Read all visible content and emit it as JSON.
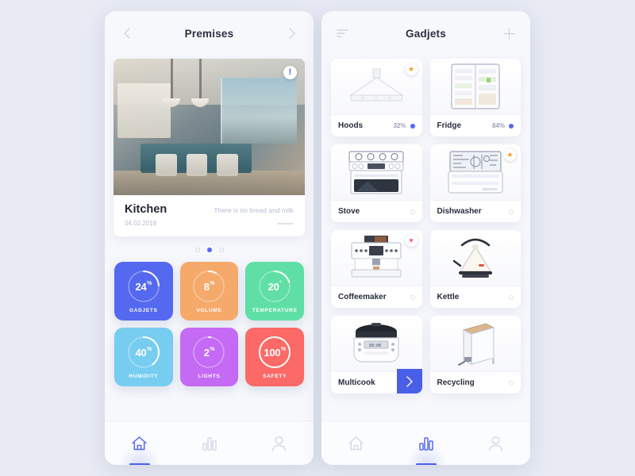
{
  "app": {
    "background_color": "#e8ebf4",
    "accent_color": "#5468f0"
  },
  "left_panel": {
    "header": {
      "title": "Premises",
      "prev_icon": "chevron-left-icon",
      "next_icon": "chevron-right-icon"
    },
    "hero": {
      "name": "Kitchen",
      "date": "04.02.2018",
      "note": "There is no bread and milk",
      "alert_badge": "!"
    },
    "pager": {
      "count": 3,
      "active_index": 1
    },
    "tiles": [
      {
        "value": "24",
        "unit": "%",
        "label": "GADJETS",
        "percent": 24,
        "color": "#5468f0"
      },
      {
        "value": "8",
        "unit": "%",
        "label": "VOLUME",
        "percent": 8,
        "color": "#f5a96b"
      },
      {
        "value": "20",
        "unit": "°",
        "label": "TEMPERATURE",
        "percent": 20,
        "color": "#5fdfa6"
      },
      {
        "value": "40",
        "unit": "%",
        "label": "HUMIDITY",
        "percent": 40,
        "color": "#76cdf0"
      },
      {
        "value": "2",
        "unit": "%",
        "label": "LIGHTS",
        "percent": 2,
        "color": "#c46af5"
      },
      {
        "value": "100",
        "unit": "%",
        "label": "SAFETY",
        "percent": 100,
        "color": "#fb6a67"
      }
    ],
    "tabs": [
      {
        "icon": "home-icon",
        "name": "tab-home",
        "active": true
      },
      {
        "icon": "chart-icon",
        "name": "tab-stats",
        "active": false
      },
      {
        "icon": "user-icon",
        "name": "tab-profile",
        "active": false
      }
    ]
  },
  "right_panel": {
    "header": {
      "title": "Gadjets",
      "filter_icon": "filter-sort-icon",
      "add_icon": "plus-icon"
    },
    "gadgets": [
      {
        "name": "Hoods",
        "percent": "32%",
        "status": "on",
        "flag": "star",
        "thumb": "range-hood-icon",
        "next": false
      },
      {
        "name": "Fridge",
        "percent": "84%",
        "status": "on",
        "flag": null,
        "thumb": "fridge-icon",
        "next": false
      },
      {
        "name": "Stove",
        "percent": "",
        "status": "off",
        "flag": null,
        "thumb": "stove-icon",
        "next": false
      },
      {
        "name": "Dishwasher",
        "percent": "",
        "status": "off",
        "flag": "star",
        "thumb": "dishwasher-icon",
        "next": false
      },
      {
        "name": "Coffeemaker",
        "percent": "",
        "status": "off",
        "flag": "heart",
        "thumb": "coffeemaker-icon",
        "next": false
      },
      {
        "name": "Kettle",
        "percent": "",
        "status": "off",
        "flag": null,
        "thumb": "kettle-icon",
        "next": false
      },
      {
        "name": "Multicook",
        "percent": "",
        "status": "off",
        "flag": null,
        "thumb": "multicooker-icon",
        "next": true
      },
      {
        "name": "Recycling",
        "percent": "",
        "status": "off",
        "flag": null,
        "thumb": "trash-bin-icon",
        "next": false
      }
    ],
    "tabs": [
      {
        "icon": "home-icon",
        "name": "tab-home",
        "active": false
      },
      {
        "icon": "chart-icon",
        "name": "tab-stats",
        "active": true
      },
      {
        "icon": "user-icon",
        "name": "tab-profile",
        "active": false
      }
    ]
  }
}
